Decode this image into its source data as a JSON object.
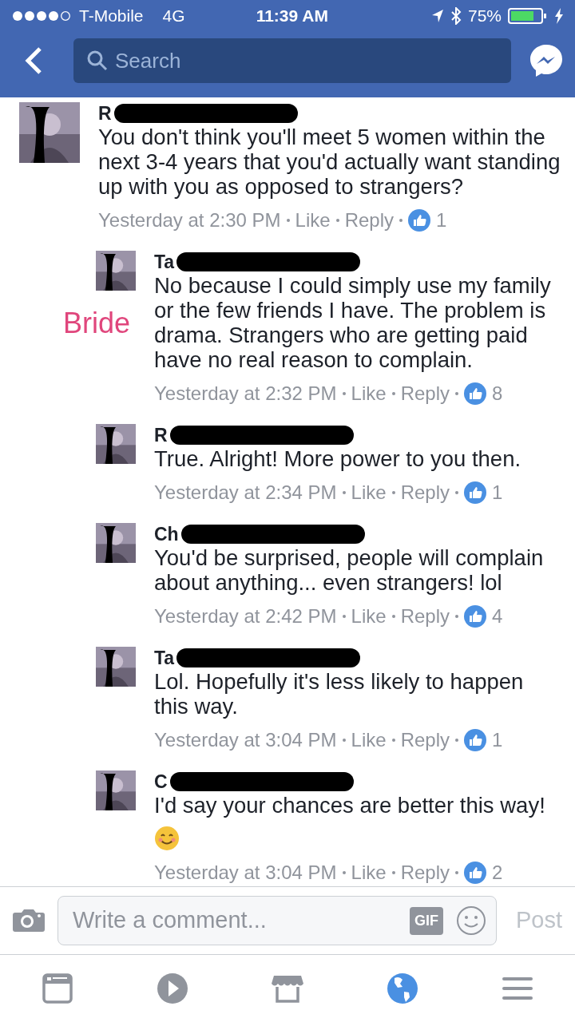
{
  "status_bar": {
    "carrier": "T-Mobile",
    "network": "4G",
    "time": "11:39 AM",
    "battery": "75%"
  },
  "search": {
    "placeholder": "Search"
  },
  "comments": [
    {
      "name": "R",
      "text": "You don't think you'll meet 5 women within the next 3-4 years that you'd actually want standing up with you as opposed to strangers?",
      "time": "Yesterday at 2:30 PM",
      "like": "Like",
      "reply": "Reply",
      "reactions": "1",
      "emoji": false,
      "children": [
        {
          "name": "Ta",
          "text": "No because I could simply use my family or the few friends I have. The problem is drama. Strangers who are getting paid have no real reason to complain.",
          "time": "Yesterday at 2:32 PM",
          "like": "Like",
          "reply": "Reply",
          "reactions": "8",
          "emoji": false,
          "annotation": "Bride"
        },
        {
          "name": "R",
          "text": "True. Alright! More power to you then.",
          "time": "Yesterday at 2:34 PM",
          "like": "Like",
          "reply": "Reply",
          "reactions": "1",
          "emoji": false
        },
        {
          "name": "Ch",
          "text": "You'd be surprised, people will complain about anything... even strangers! lol",
          "time": "Yesterday at 2:42 PM",
          "like": "Like",
          "reply": "Reply",
          "reactions": "4",
          "emoji": false
        },
        {
          "name": "Ta",
          "text": "Lol. Hopefully it's less likely to happen this way.",
          "time": "Yesterday at 3:04 PM",
          "like": "Like",
          "reply": "Reply",
          "reactions": "1",
          "emoji": false
        },
        {
          "name": "C",
          "text": "I'd say your chances are better this way!",
          "time": "Yesterday at 3:04 PM",
          "like": "Like",
          "reply": "Reply",
          "reactions": "2",
          "emoji": true
        }
      ]
    }
  ],
  "composer": {
    "placeholder": "Write a comment...",
    "gif": "GIF",
    "post": "Post"
  },
  "tabs": [
    {
      "kind": "feed",
      "selected": false
    },
    {
      "kind": "video",
      "selected": false
    },
    {
      "kind": "market",
      "selected": false
    },
    {
      "kind": "globe",
      "selected": true
    },
    {
      "kind": "menu",
      "selected": false
    }
  ]
}
